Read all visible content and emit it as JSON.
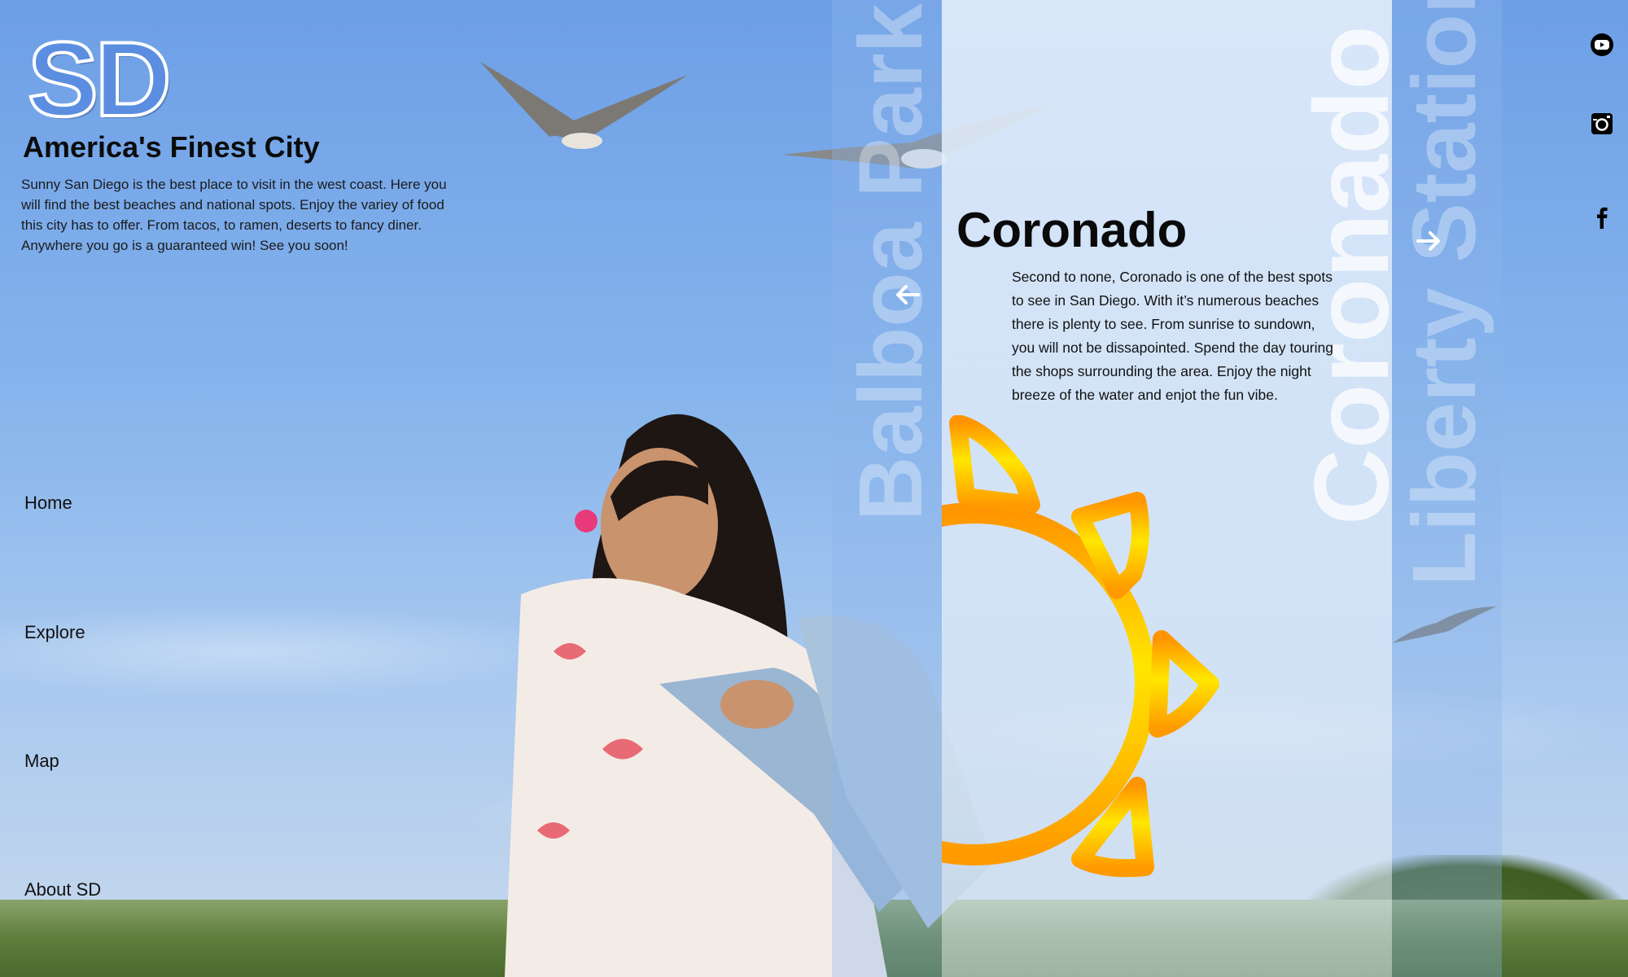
{
  "brand": {
    "logo": "SD",
    "tagline": "America's Finest City",
    "intro": "Sunny San Diego is the best place to visit in the west coast. Here you will find the best beaches and national spots. Enjoy the variey of food this city has to offer. From tacos, to ramen, deserts to fancy diner. Anywhere you go is a guaranteed win! See you soon!"
  },
  "nav": {
    "items": [
      {
        "label": "Home"
      },
      {
        "label": "Explore"
      },
      {
        "label": "Map"
      },
      {
        "label": "About SD"
      }
    ]
  },
  "social": {
    "icons": [
      "youtube-icon",
      "instagram-icon",
      "facebook-icon"
    ]
  },
  "carousel": {
    "prev_slide": "Balboa Park",
    "current_slide": "Coronado",
    "next_slide": "Liberty Station",
    "feature": {
      "title": "Coronado",
      "text": "Second to none, Coronado is one of the best spots to see in San Diego. With it’s numerous beaches there is plenty to see. From sunrise to sundown, you will not be dissapointed. Spend the day touring the shops surrounding the area. Enjoy the night breeze of the water and enjot the fun vibe."
    },
    "prev_arrow": "arrow-left-icon",
    "next_arrow": "arrow-right-icon"
  },
  "colors": {
    "logo_fill": "#5b8ee0",
    "sun_orange": "#ff9a00",
    "sun_yellow": "#ffe600"
  }
}
